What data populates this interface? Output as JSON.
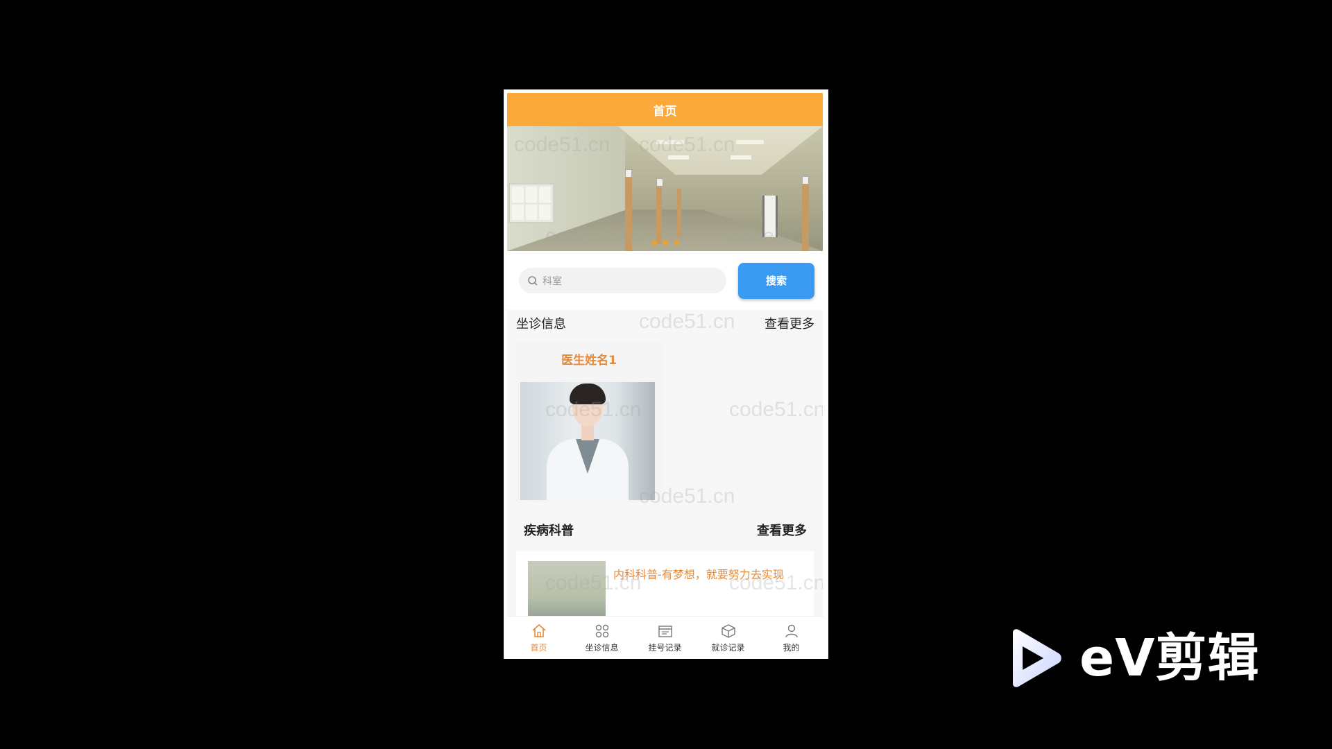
{
  "header": {
    "title": "首页"
  },
  "banner": {
    "dots": 3
  },
  "search": {
    "placeholder": "科室",
    "button_label": "搜索"
  },
  "sections": {
    "doctors": {
      "title": "坐诊信息",
      "more": "查看更多"
    },
    "articles": {
      "title": "疾病科普",
      "more": "查看更多"
    }
  },
  "doctors": [
    {
      "name": "医生姓名1"
    }
  ],
  "articles": [
    {
      "title": "内科科普-有梦想，就要努力去实现"
    }
  ],
  "tabs": [
    {
      "label": "首页",
      "icon": "home-icon",
      "active": true
    },
    {
      "label": "坐诊信息",
      "icon": "grid-icon",
      "active": false
    },
    {
      "label": "挂号记录",
      "icon": "calendar-icon",
      "active": false
    },
    {
      "label": "就诊记录",
      "icon": "box-icon",
      "active": false
    },
    {
      "label": "我的",
      "icon": "user-icon",
      "active": false
    }
  ],
  "watermark": "code51.cn",
  "overlay_logo": {
    "text": "eV剪辑"
  },
  "colors": {
    "accent": "#fca93b",
    "primary": "#3b9bf3",
    "highlight": "#e58a3a"
  }
}
